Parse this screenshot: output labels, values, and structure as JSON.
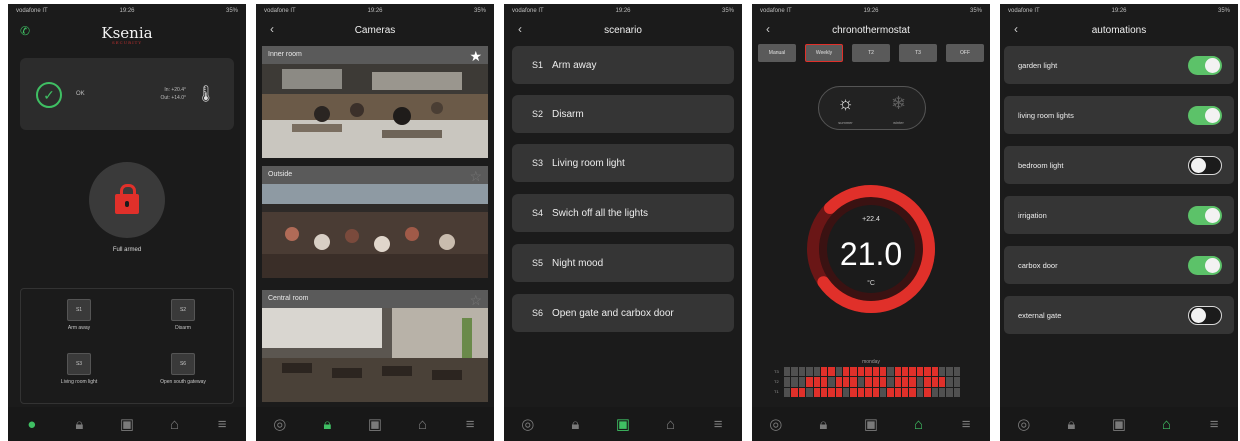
{
  "status_bar": {
    "carrier": "vodafone IT",
    "time": "19:26",
    "battery": "35%"
  },
  "home": {
    "logo": "Ksenia",
    "logo_sub": "SECURITY",
    "status_text": "OK",
    "temp_in": "In: +20.4°",
    "temp_out": "Out: +14.0°",
    "arm_label": "Full armed",
    "scenarios": [
      {
        "code": "S1",
        "label": "Arm away"
      },
      {
        "code": "S2",
        "label": "Disarm"
      },
      {
        "code": "S3",
        "label": "Living room light"
      },
      {
        "code": "S6",
        "label": "Open south gateway"
      }
    ]
  },
  "cameras": {
    "title": "Cameras",
    "items": [
      {
        "name": "Inner room",
        "starred": true
      },
      {
        "name": "Outside",
        "starred": false
      },
      {
        "name": "Central room",
        "starred": false
      }
    ]
  },
  "scenario": {
    "title": "scenario",
    "items": [
      {
        "code": "S1",
        "label": "Arm away"
      },
      {
        "code": "S2",
        "label": "Disarm"
      },
      {
        "code": "S3",
        "label": "Living room light"
      },
      {
        "code": "S4",
        "label": "Swich off all the lights"
      },
      {
        "code": "S5",
        "label": "Night mood"
      },
      {
        "code": "S6",
        "label": "Open gate and carbox door"
      }
    ]
  },
  "chrono": {
    "title": "chronothermostat",
    "modes": [
      "Manual",
      "Weekly",
      "T2",
      "T3",
      "OFF"
    ],
    "active_mode": "Weekly",
    "season_summer": "summer",
    "season_winter": "winter",
    "current_temp": "+22.4",
    "setpoint": "21.0",
    "unit": "°C",
    "day_label": "monday",
    "row_labels": [
      "T3",
      "T2",
      "T1"
    ],
    "setpoint_fraction": 0.78
  },
  "automations": {
    "title": "automations",
    "items": [
      {
        "label": "garden light",
        "on": true
      },
      {
        "label": "living room lights",
        "on": true
      },
      {
        "label": "bedroom light",
        "on": false
      },
      {
        "label": "irrigation",
        "on": true
      },
      {
        "label": "carbox door",
        "on": true
      },
      {
        "label": "external gate",
        "on": false
      }
    ]
  },
  "colors": {
    "accent_green": "#3fbf63",
    "accent_red": "#e0302a",
    "background": "#1b1b1b",
    "card": "#353535"
  }
}
